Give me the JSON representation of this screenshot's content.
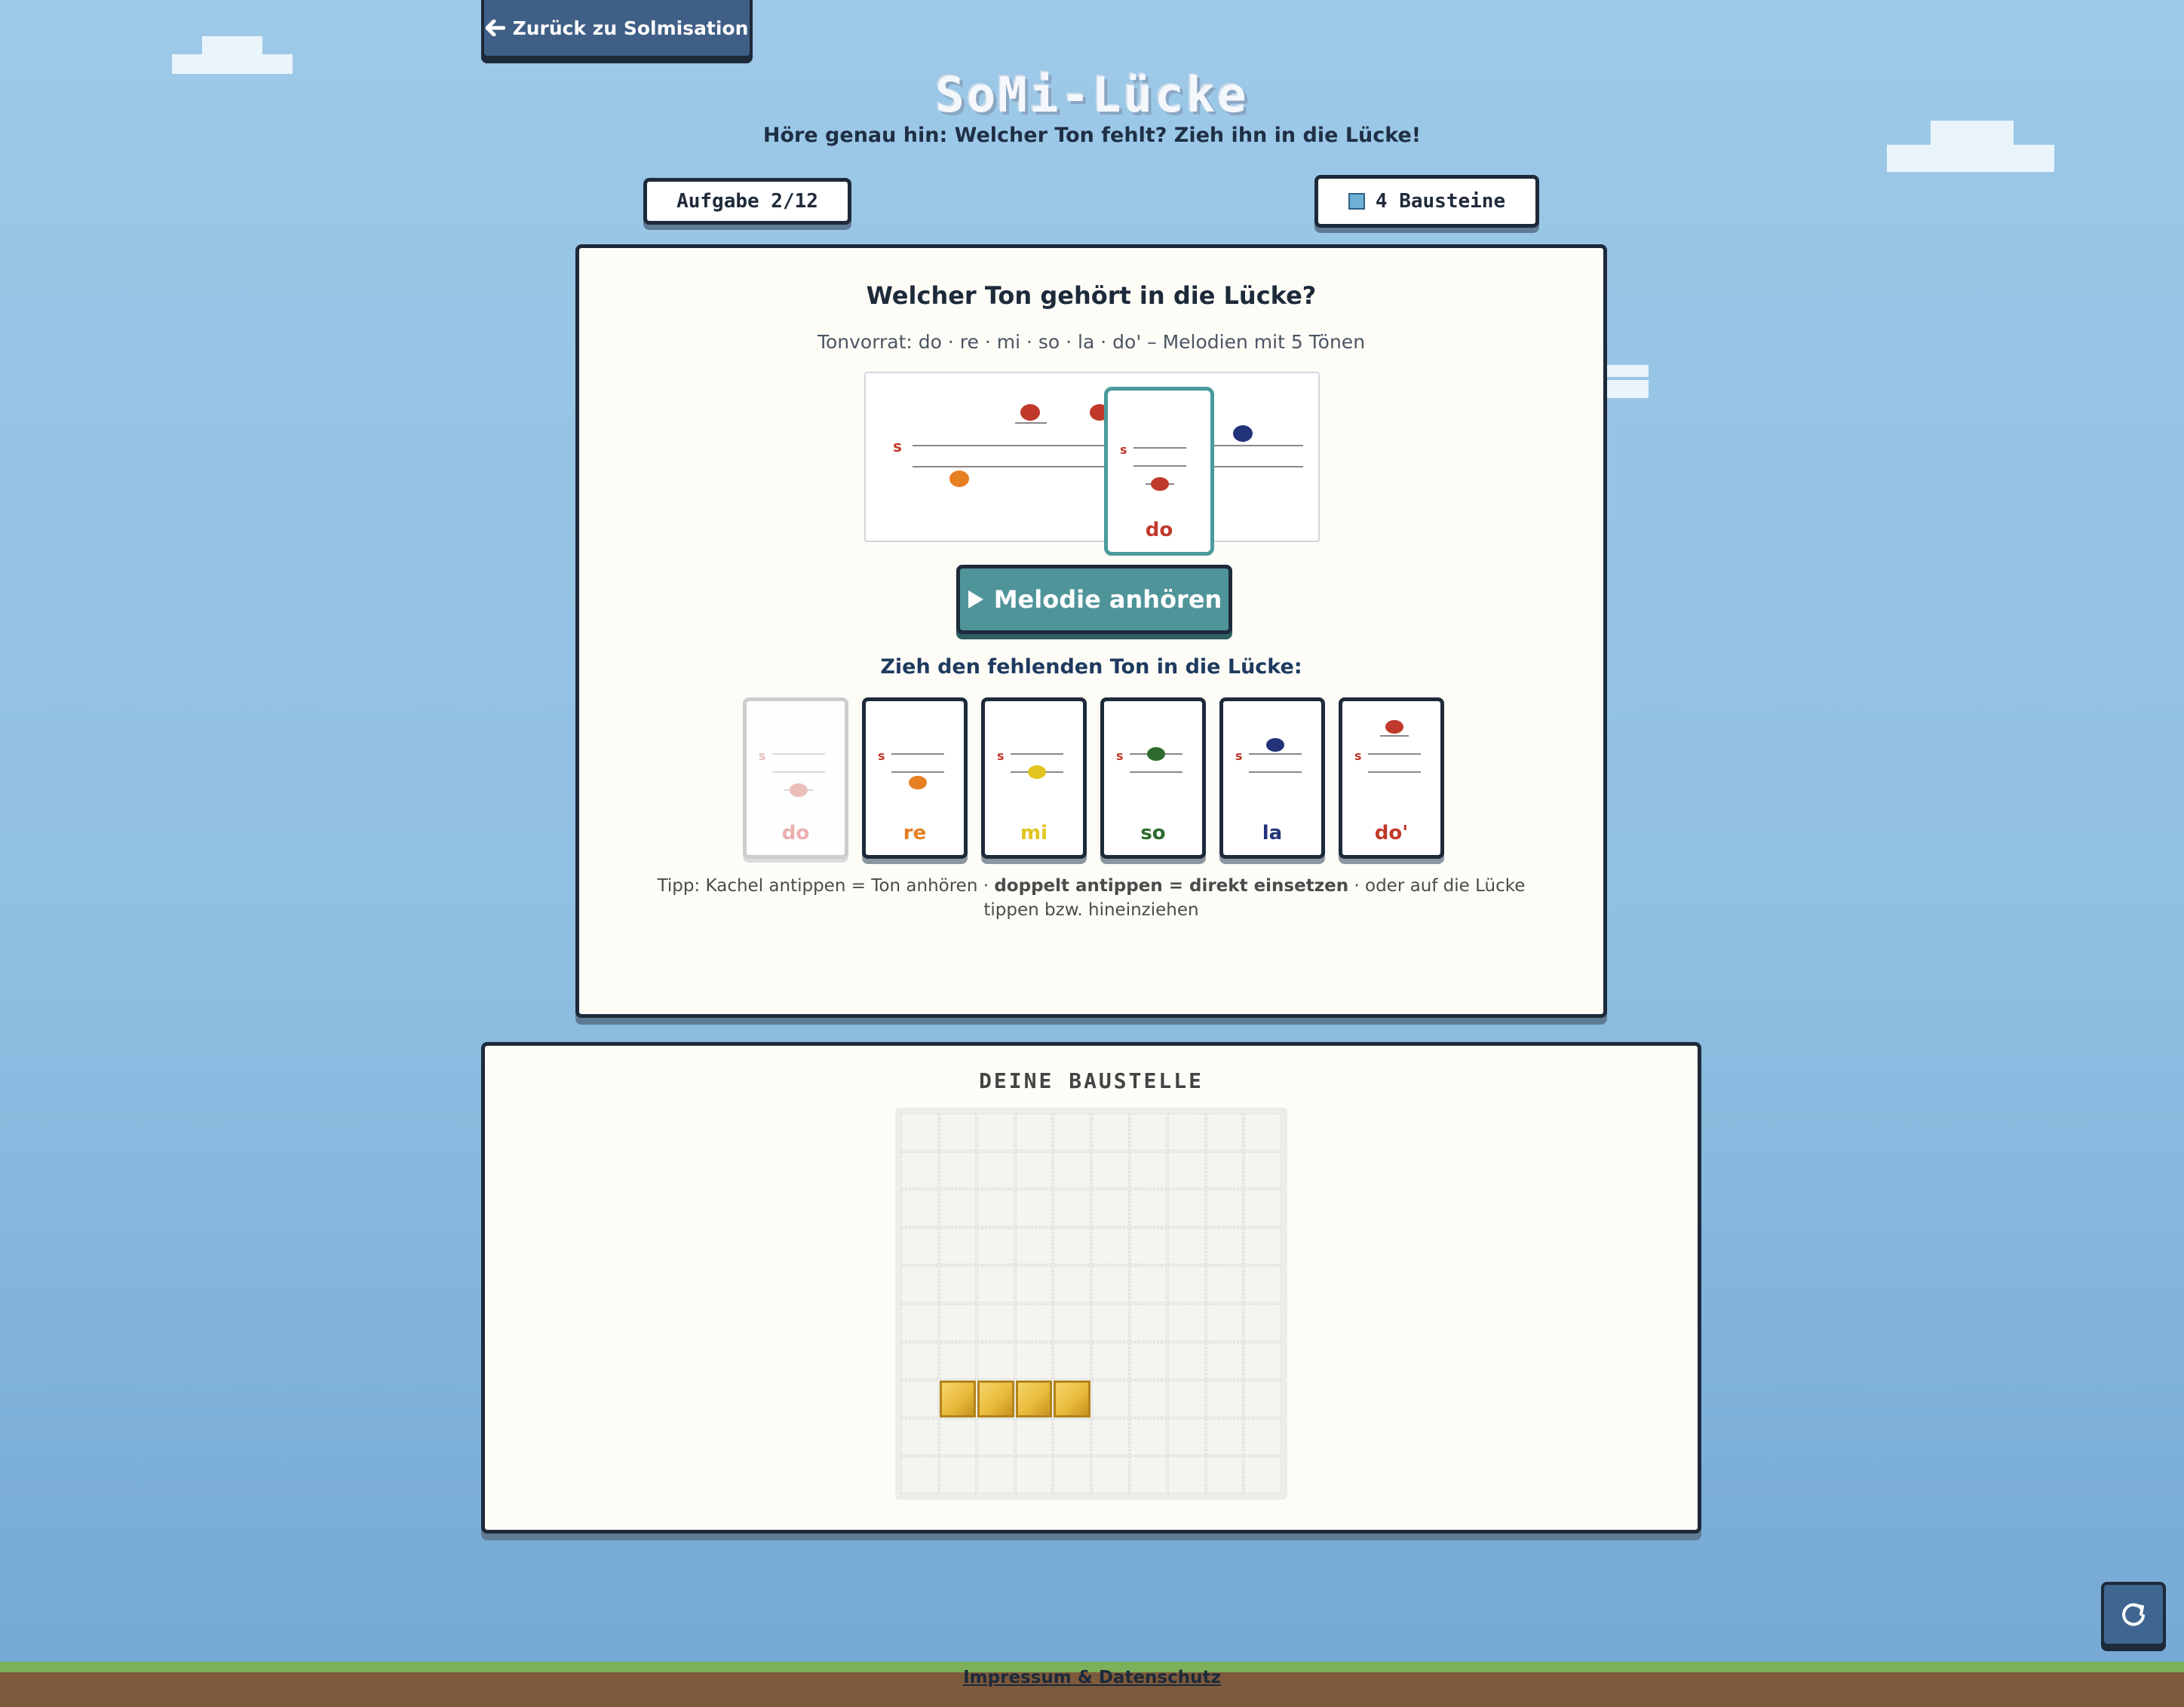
{
  "back_button": {
    "label": "Zurück zu Solmisation",
    "icon": "arrow-left-icon"
  },
  "header": {
    "title": "SoMi-Lücke",
    "subtitle": "Höre genau hin: Welcher Ton fehlt? Zieh ihn in die Lücke!"
  },
  "progress": {
    "task_label": "Aufgabe 2/12",
    "bricks_label": "4 Bausteine"
  },
  "quiz": {
    "question": "Welcher Ton gehört in die Lücke?",
    "info": "Tonvorrat: do · re · mi · so · la · do' – Melodien mit 5 Tönen",
    "staff_marker": "s",
    "melody": [
      "re",
      "do'",
      "do'",
      "do",
      "la"
    ],
    "gap": {
      "label": "do",
      "color": "#c0392b"
    },
    "play_button": "Melodie anhören",
    "drag_label": "Zieh den fehlenden Ton in die Lücke:",
    "tiles": [
      {
        "label": "do",
        "color": "#c0392b",
        "used": true
      },
      {
        "label": "re",
        "color": "#e67e22",
        "used": false
      },
      {
        "label": "mi",
        "color": "#e2c51e",
        "used": false
      },
      {
        "label": "so",
        "color": "#2e6b2e",
        "used": false
      },
      {
        "label": "la",
        "color": "#22337a",
        "used": false
      },
      {
        "label": "do'",
        "color": "#c0392b",
        "used": false
      }
    ],
    "tip_1": "Tipp: Kachel antippen = Ton anhören · ",
    "tip_bold": "doppelt antippen = direkt einsetzen",
    "tip_2": " · oder auf die Lücke tippen bzw. hineinziehen"
  },
  "build": {
    "title": "DEINE BAUSTELLE",
    "grid_size": 10,
    "filled_row": 8,
    "filled_count": 4
  },
  "reset_button": {
    "icon": "refresh-icon"
  },
  "footer": {
    "link": "Impressum & Datenschutz"
  },
  "colors": {
    "accent": "#4f9499",
    "panel_border": "#1d2a3a",
    "sky": "#9ec9e8"
  }
}
